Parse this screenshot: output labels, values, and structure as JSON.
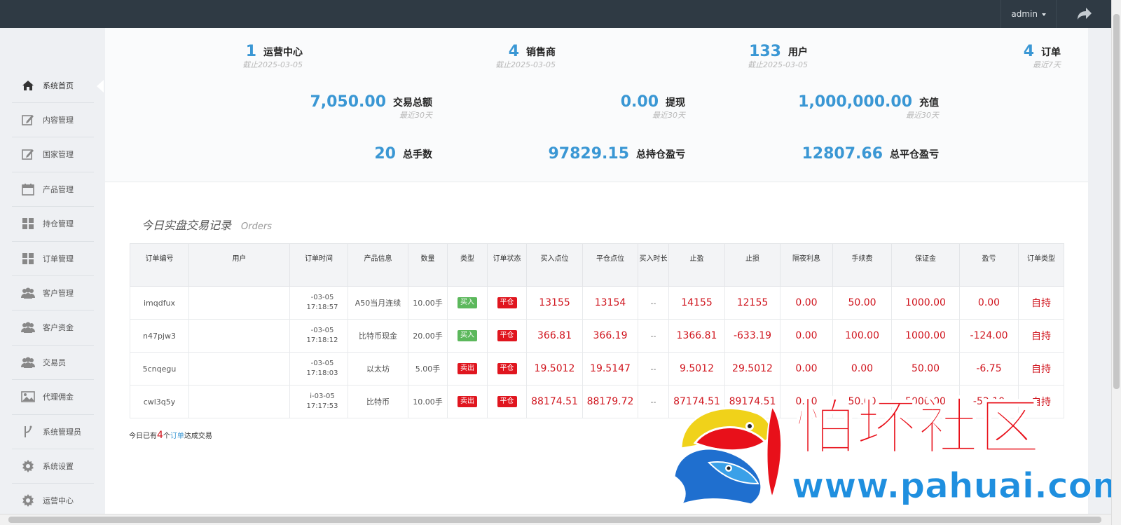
{
  "header": {
    "user": "admin"
  },
  "sidebar": {
    "items": [
      {
        "label": "系统首页",
        "icon": "home-icon"
      },
      {
        "label": "内容管理",
        "icon": "edit-icon"
      },
      {
        "label": "国家管理",
        "icon": "edit-icon"
      },
      {
        "label": "产品管理",
        "icon": "calendar-icon"
      },
      {
        "label": "持仓管理",
        "icon": "grid-icon"
      },
      {
        "label": "订单管理",
        "icon": "grid-icon"
      },
      {
        "label": "客户管理",
        "icon": "users-icon"
      },
      {
        "label": "客户资金",
        "icon": "users-icon"
      },
      {
        "label": "交易员",
        "icon": "users-icon"
      },
      {
        "label": "代理佣金",
        "icon": "image-icon"
      },
      {
        "label": "系统管理员",
        "icon": "fork-icon"
      },
      {
        "label": "系统设置",
        "icon": "gear-icon"
      },
      {
        "label": "运营中心",
        "icon": "gear-icon"
      }
    ]
  },
  "stats": {
    "row1": [
      {
        "value": "1",
        "label": "运营中心",
        "sub": "截止2025-03-05"
      },
      {
        "value": "4",
        "label": "销售商",
        "sub": "截止2025-03-05"
      },
      {
        "value": "133",
        "label": "用户",
        "sub": "截止2025-03-05"
      },
      {
        "value": "4",
        "label": "订单",
        "sub": "最近7天"
      }
    ],
    "row2": [
      {
        "value": "7,050.00",
        "label": "交易总额",
        "sub": "最近30天"
      },
      {
        "value": "0.00",
        "label": "提现",
        "sub": "最近30天"
      },
      {
        "value": "1,000,000.00",
        "label": "充值",
        "sub": "最近30天"
      }
    ],
    "row3": [
      {
        "value": "20",
        "label": "总手数"
      },
      {
        "value": "97829.15",
        "label": "总持仓盈亏"
      },
      {
        "value": "12807.66",
        "label": "总平仓盈亏"
      }
    ]
  },
  "orders": {
    "title": "今日实盘交易记录",
    "title_en": "Orders",
    "columns": [
      "订单编号",
      "用户",
      "订单时间",
      "产品信息",
      "数量",
      "类型",
      "订单状态",
      "买入点位",
      "平仓点位",
      "买入时长",
      "止盈",
      "止损",
      "隔夜利息",
      "手续费",
      "保证金",
      "盈亏",
      "订单类型"
    ],
    "rows": [
      {
        "id": "imqdfux",
        "user": "",
        "date": "-03-05",
        "time": "17:18:57",
        "product": "A50当月连续",
        "qty": "10.00手",
        "type": "买入",
        "status": "平仓",
        "buy": "13155",
        "close": "13154",
        "duration": "--",
        "tp": "14155",
        "sl": "12155",
        "interest": "0.00",
        "fee": "50.00",
        "margin": "1000.00",
        "pnl": "0.00",
        "otype": "自持"
      },
      {
        "id": "n47pjw3",
        "user": "",
        "date": "-03-05",
        "time": "17:18:12",
        "product": "比特币现金",
        "qty": "20.00手",
        "type": "买入",
        "status": "平仓",
        "buy": "366.81",
        "close": "366.19",
        "duration": "--",
        "tp": "1366.81",
        "sl": "-633.19",
        "interest": "0.00",
        "fee": "100.00",
        "margin": "1000.00",
        "pnl": "-124.00",
        "otype": "自持"
      },
      {
        "id": "5cnqegu",
        "user": "",
        "date": "-03-05",
        "time": "17:18:03",
        "product": "以太坊",
        "qty": "5.00手",
        "type": "卖出",
        "status": "平仓",
        "buy": "19.5012",
        "close": "19.5147",
        "duration": "--",
        "tp": "9.5012",
        "sl": "29.5012",
        "interest": "0.00",
        "fee": "0.00",
        "margin": "50.00",
        "pnl": "-6.75",
        "otype": "自持"
      },
      {
        "id": "cwl3q5y",
        "user": "",
        "date": "i-03-05",
        "time": "17:17:53",
        "product": "比特币",
        "qty": "10.00手",
        "type": "卖出",
        "status": "平仓",
        "buy": "88174.51",
        "close": "88179.72",
        "duration": "--",
        "tp": "87174.51",
        "sl": "89174.51",
        "interest": "0.00",
        "fee": "50.00",
        "margin": "5000.00",
        "pnl": "-52.10",
        "otype": "自持"
      }
    ],
    "summary": {
      "prefix": "今日已有",
      "count": "4",
      "mid": "个",
      "link": "订单",
      "suffix": "达成交易"
    }
  },
  "watermark": {
    "cn": "怕坏社区",
    "url": "www.pahuai.com"
  },
  "colors": {
    "accent": "#3a97d4",
    "danger": "#d0151e",
    "topbar": "#2f3a44",
    "buy": "#5cb85c"
  }
}
